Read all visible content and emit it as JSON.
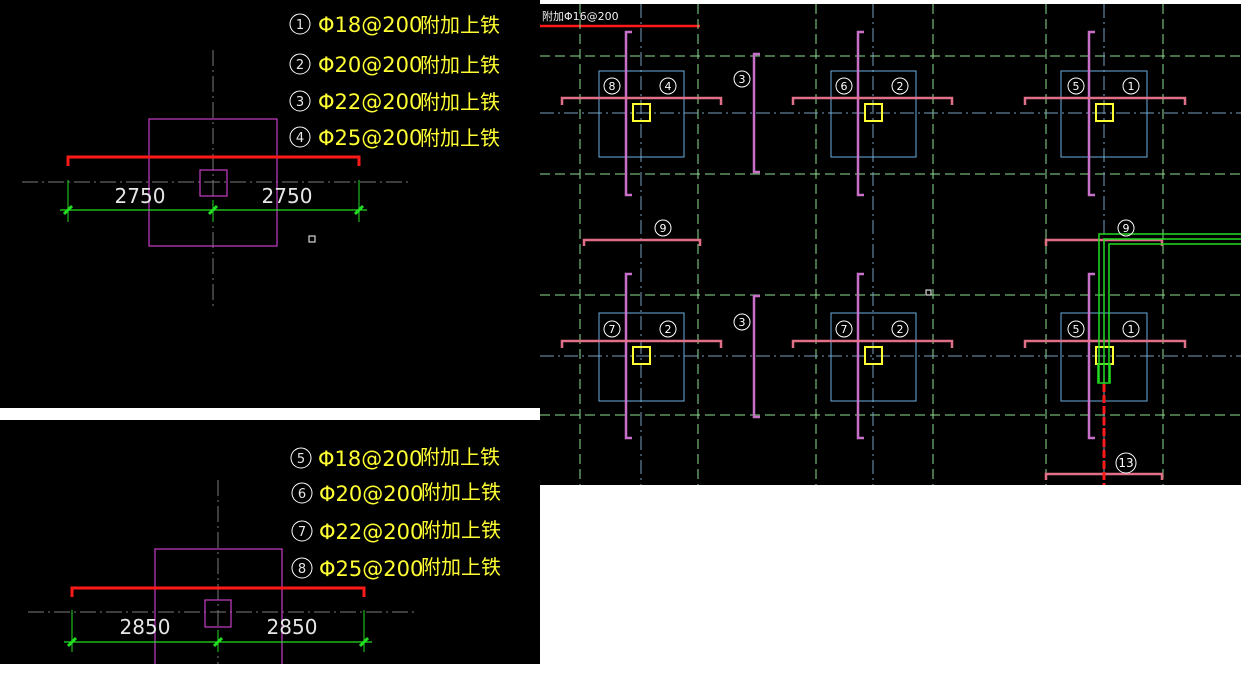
{
  "detail_top": {
    "legend": [
      {
        "num": "1",
        "spec": "Φ18@200",
        "note": "附加上铁"
      },
      {
        "num": "2",
        "spec": "Φ20@200",
        "note": "附加上铁"
      },
      {
        "num": "3",
        "spec": "Φ22@200",
        "note": "附加上铁"
      },
      {
        "num": "4",
        "spec": "Φ25@200",
        "note": "附加上铁"
      }
    ],
    "dim_left": "2750",
    "dim_right": "2750"
  },
  "detail_bottom": {
    "legend": [
      {
        "num": "5",
        "spec": "Φ18@200",
        "note": "附加上铁"
      },
      {
        "num": "6",
        "spec": "Φ20@200",
        "note": "附加上铁"
      },
      {
        "num": "7",
        "spec": "Φ22@200",
        "note": "附加上铁"
      },
      {
        "num": "8",
        "spec": "Φ25@200",
        "note": "附加上铁"
      }
    ],
    "dim_left": "2850",
    "dim_right": "2850"
  },
  "plan": {
    "header_label": "附加Φ16@200",
    "tags": {
      "r1c1_left": "8",
      "r1c1_right": "4",
      "r1c2_left": "6",
      "r1c2_right": "2",
      "r1c3_left": "5",
      "r1c3_right": "1",
      "mid1": "3",
      "mid2": "3",
      "span_left": "9",
      "span_right": "9",
      "r2c1_left": "7",
      "r2c1_right": "2",
      "r2c2_left": "7",
      "r2c2_right": "2",
      "r2c3_left": "5",
      "r2c3_right": "1",
      "bottom": "13"
    }
  },
  "colors": {
    "rebar_red": "#ff1a1a",
    "column_magenta": "#c83cc8",
    "dim_green": "#22dd22",
    "text_yellow": "#ffff33",
    "axis_green": "#8fe08f",
    "bar_pink": "#e07088",
    "pier_blue": "#6ab0e0"
  }
}
